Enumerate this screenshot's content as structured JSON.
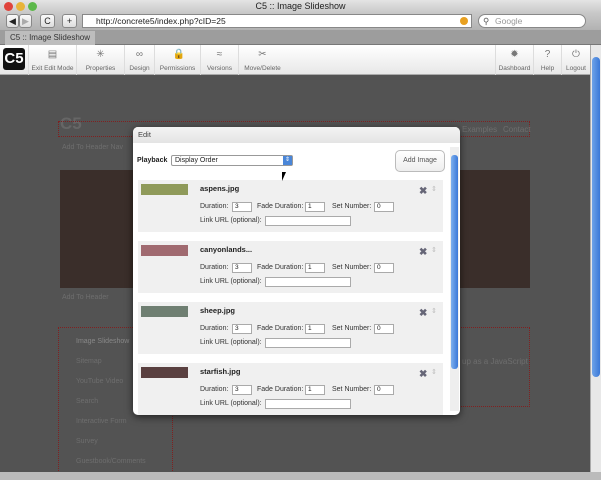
{
  "window": {
    "title": "C5 :: Image Slideshow",
    "tab": "C5 :: Image Slideshow"
  },
  "browser": {
    "url": "http://concrete5/index.php?cID=25",
    "search_placeholder": "Google",
    "back": "◀",
    "forward": "▶",
    "reload": "C",
    "add": "+"
  },
  "toolbar": {
    "logo": "C5",
    "left": [
      {
        "label": "Exit Edit Mode",
        "icon": "exit-icon",
        "glyph": "▤"
      },
      {
        "label": "Properties",
        "icon": "asterisk-icon",
        "glyph": "✳"
      },
      {
        "label": "Design",
        "icon": "glasses-icon",
        "glyph": "∞"
      },
      {
        "label": "Permissions",
        "icon": "lock-icon",
        "glyph": "🔒"
      },
      {
        "label": "Versions",
        "icon": "versions-icon",
        "glyph": "≈"
      },
      {
        "label": "Move/Delete",
        "icon": "scissors-icon",
        "glyph": "✂"
      }
    ],
    "right": [
      {
        "label": "Dashboard",
        "icon": "gear-icon",
        "glyph": "✹"
      },
      {
        "label": "Help",
        "icon": "help-icon",
        "glyph": "?"
      },
      {
        "label": "Logout",
        "icon": "logout-icon",
        "glyph": "⏻"
      }
    ]
  },
  "background_page": {
    "logo": "C5",
    "header_nav_area": "Add To Header Nav",
    "nav_links": [
      "Examples",
      "Contact"
    ],
    "header_area": "Add To Header",
    "sidebar": [
      "Image Slideshow",
      "Sitemap",
      "YouTube Video",
      "Search",
      "Interactive Form",
      "Survey",
      "Guestbook/Comments"
    ],
    "content_fragment": "up as a JavaScript"
  },
  "modal": {
    "title": "Edit",
    "playback_label": "Playback",
    "playback_value": "Display Order",
    "add_image": "Add Image",
    "labels": {
      "duration": "Duration:",
      "fade": "Fade Duration:",
      "set": "Set Number:",
      "link": "Link URL (optional):"
    },
    "images": [
      {
        "name": "aspens.jpg",
        "duration": "3",
        "fade": "1",
        "set": "0",
        "link": "",
        "color": "#8f9a5a"
      },
      {
        "name": "canyonlands...",
        "duration": "3",
        "fade": "1",
        "set": "0",
        "link": "",
        "color": "#a06a70"
      },
      {
        "name": "sheep.jpg",
        "duration": "3",
        "fade": "1",
        "set": "0",
        "link": "",
        "color": "#6f7f72"
      },
      {
        "name": "starfish.jpg",
        "duration": "3",
        "fade": "1",
        "set": "0",
        "link": "",
        "color": "#5a4040"
      }
    ]
  }
}
